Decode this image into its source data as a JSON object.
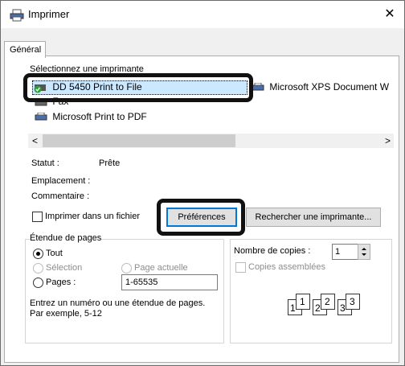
{
  "window": {
    "title": "Imprimer",
    "close_glyph": "✕"
  },
  "tabs": [
    {
      "label": "Général"
    }
  ],
  "printers": {
    "group_label": "Sélectionnez une imprimante",
    "items": [
      {
        "name": "DD 5450 Print to File",
        "icon": "printer-default-icon"
      },
      {
        "name": "Microsoft XPS Document W",
        "icon": "printer-icon"
      },
      {
        "name": "Fax",
        "icon": "fax-icon"
      },
      {
        "name": "Microsoft Print to PDF",
        "icon": "printer-icon"
      }
    ],
    "scroll_left": "<",
    "scroll_right": ">"
  },
  "status": {
    "statut_label": "Statut :",
    "statut_value": "Prête",
    "emplacement_label": "Emplacement :",
    "commentaire_label": "Commentaire :"
  },
  "actions": {
    "print_to_file": "Imprimer dans un fichier",
    "preferences": "Préférences",
    "find_printer": "Rechercher une imprimante..."
  },
  "page_range": {
    "group_label": "Étendue de pages",
    "all": "Tout",
    "selection": "Sélection",
    "current_page": "Page actuelle",
    "pages": "Pages :",
    "pages_value": "1-65535",
    "help_line1": "Entrez un numéro ou une étendue de pages.",
    "help_line2": "Par exemple, 5-12"
  },
  "copies": {
    "label": "Nombre de copies :",
    "value": "1",
    "collate": "Copies assemblées",
    "collate_numbers": [
      "1",
      "1",
      "2",
      "2",
      "3",
      "3"
    ]
  },
  "colors": {
    "selection": "#cce8ff",
    "accent": "#0078d7",
    "highlight": "#111111"
  }
}
